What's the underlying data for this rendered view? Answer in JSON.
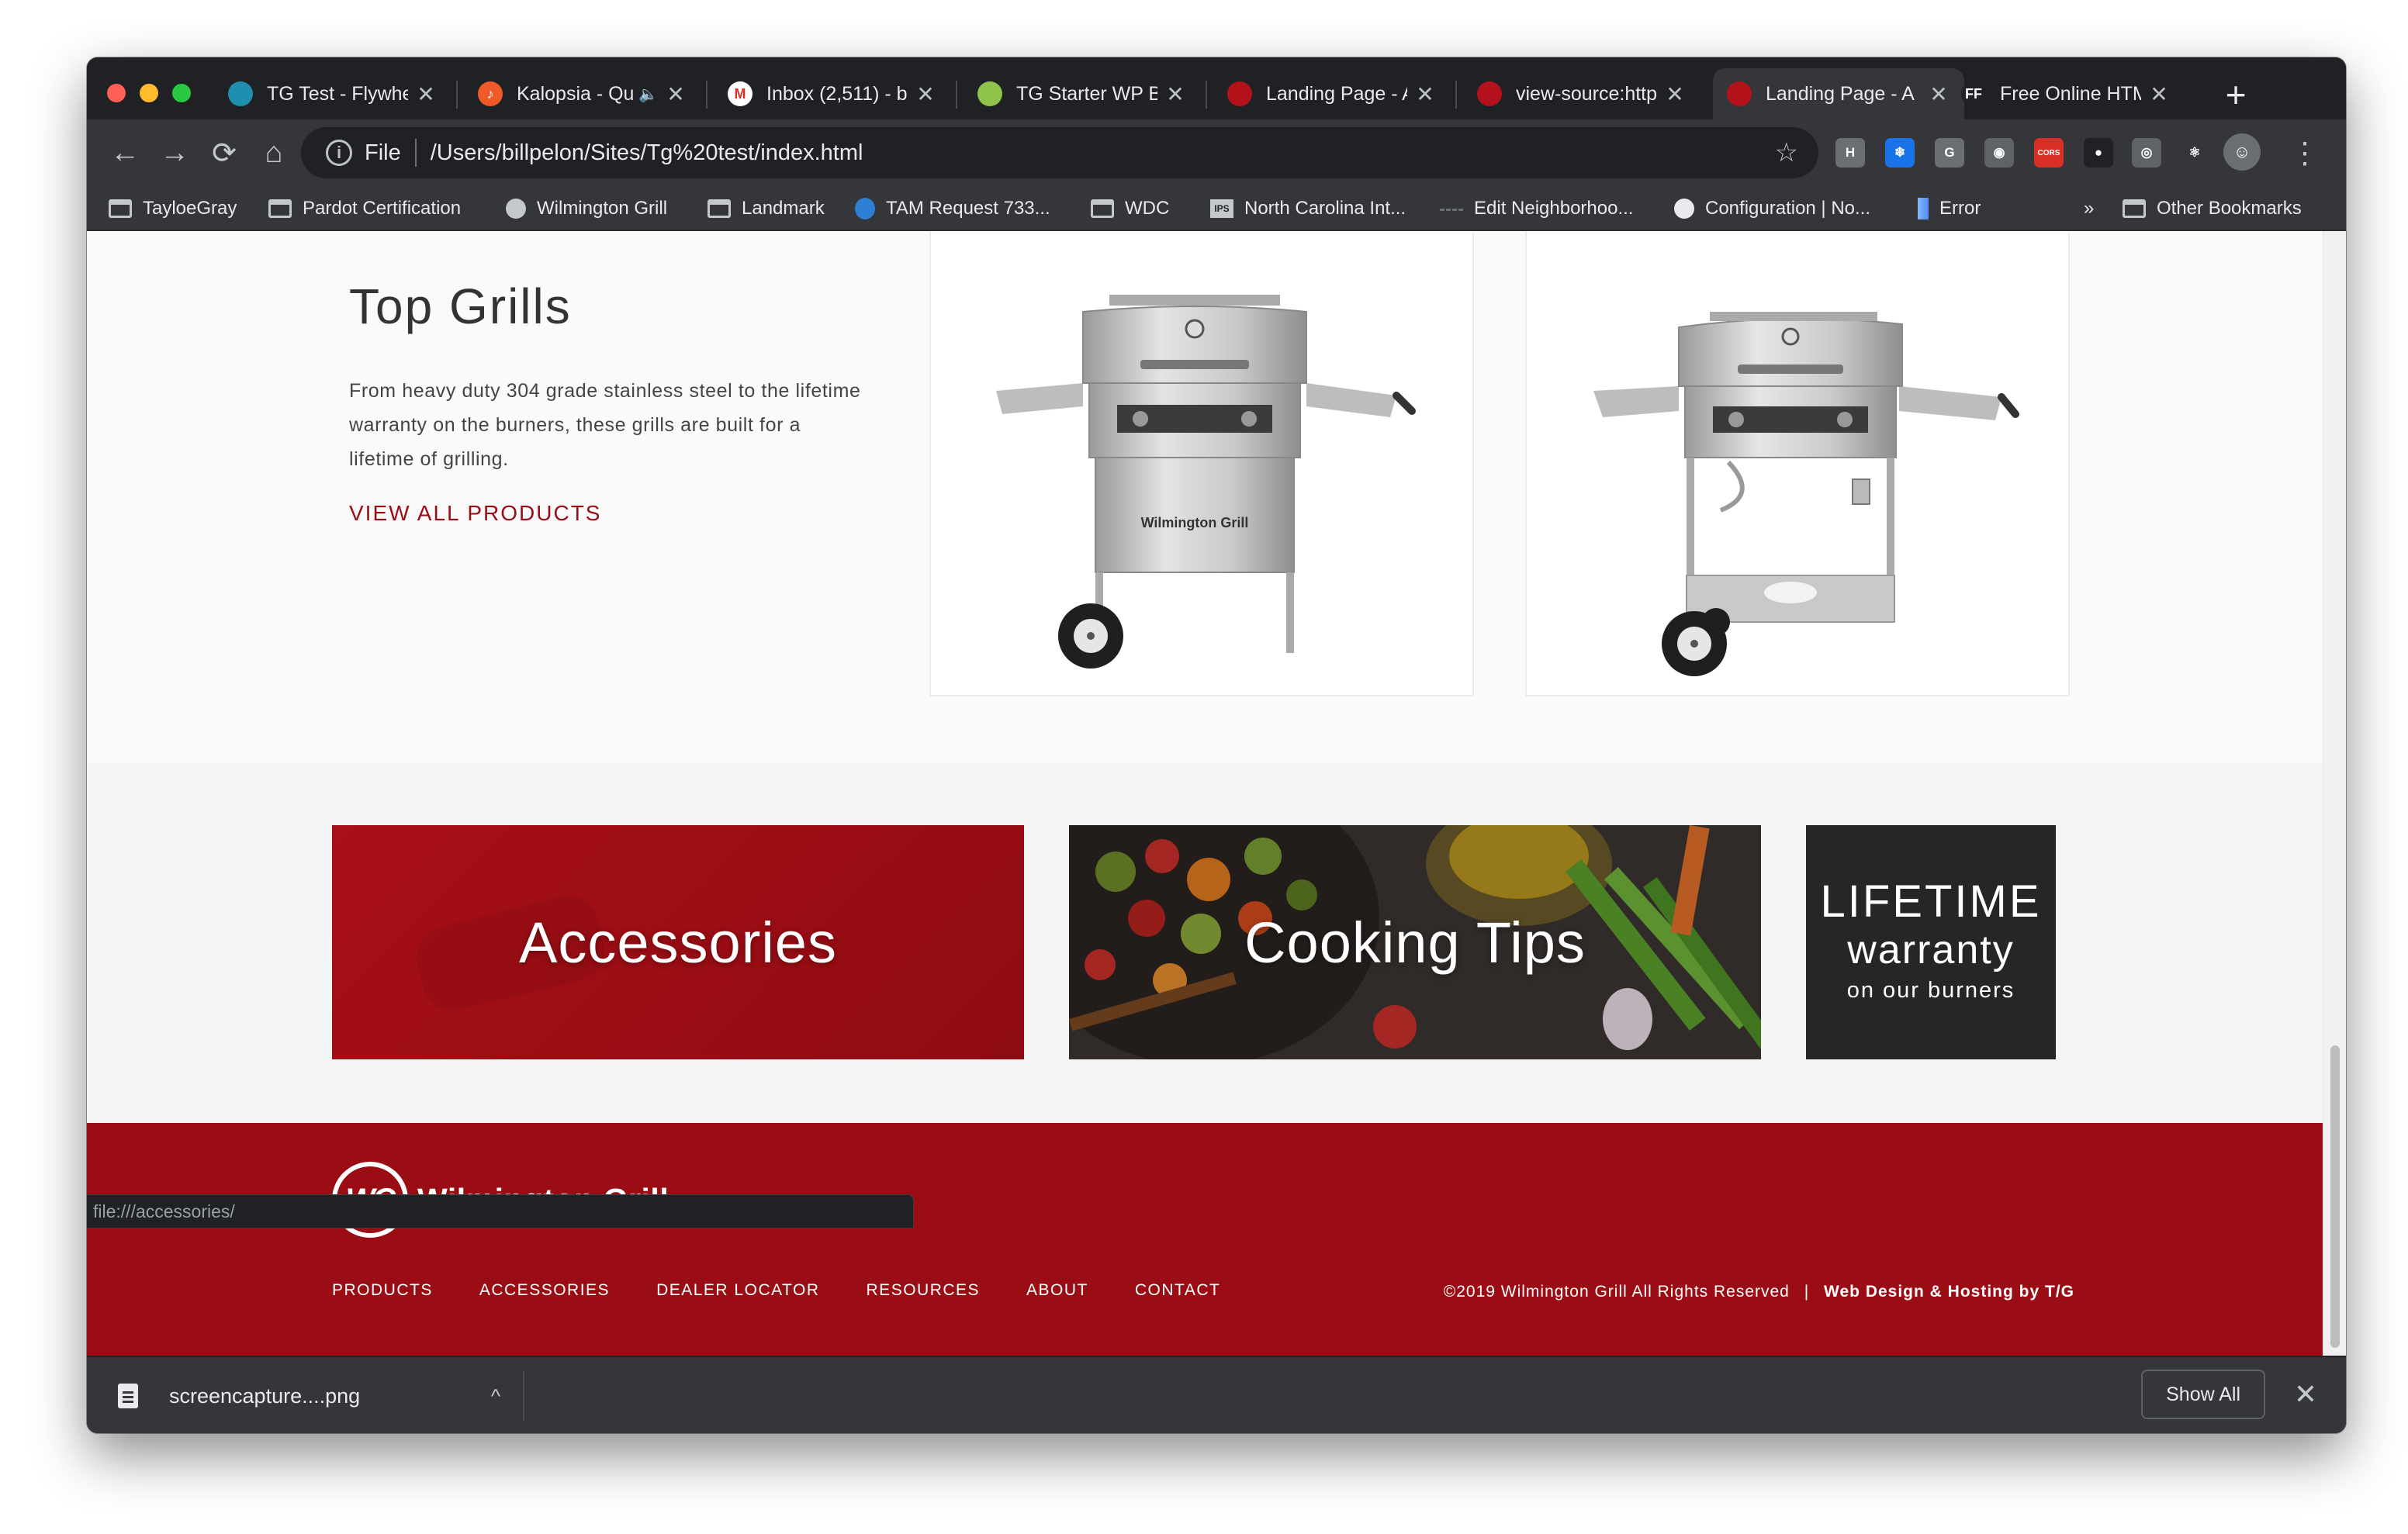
{
  "browser": {
    "tabs": [
      {
        "title": "TG Test - Flywhe",
        "favicon": "flywheel-icon",
        "color": "#1f8fb0",
        "glyph": ""
      },
      {
        "title": "Kalopsia - Qu",
        "favicon": "music-icon",
        "color": "#f05a28",
        "glyph": "♪",
        "audio": "🔈"
      },
      {
        "title": "Inbox (2,511) - bi",
        "favicon": "gmail-icon",
        "color": "#ffffff",
        "glyph": "M"
      },
      {
        "title": "TG Starter WP Bl",
        "favicon": "bitbucket-icon",
        "color": "#8fc34a",
        "glyph": ""
      },
      {
        "title": "Landing Page - A",
        "favicon": "wilmington-grill-icon",
        "color": "#b3121a",
        "glyph": ""
      },
      {
        "title": "view-source:http",
        "favicon": "wilmington-grill-icon",
        "color": "#b3121a",
        "glyph": ""
      },
      {
        "title": "Landing Page - A",
        "favicon": "wilmington-grill-icon",
        "color": "#b3121a",
        "glyph": "",
        "active": true
      },
      {
        "title": "Free Online HTM",
        "favicon": "ff-icon",
        "color": "#202124",
        "glyph": "FF"
      }
    ],
    "tab_close_glyph": "✕",
    "new_tab_glyph": "+",
    "nav": {
      "back": "←",
      "forward": "→",
      "reload": "⟳",
      "home": "⌂",
      "star": "☆",
      "menu": "⋮"
    },
    "address": {
      "info_glyph": "i",
      "scheme": "File",
      "path": "/Users/billpelon/Sites/Tg%20test/index.html"
    },
    "extensions": [
      {
        "name": "hashtag-extension-icon",
        "label": "H",
        "color": "#6b6e73"
      },
      {
        "name": "snowflake-extension-icon",
        "label": "❄",
        "color": "#1a73e8"
      },
      {
        "name": "grammarly-extension-icon",
        "label": "G",
        "color": "#6b6e73"
      },
      {
        "name": "camera-extension-icon",
        "label": "◉",
        "color": "#5f6368"
      },
      {
        "name": "cors-extension-icon",
        "label": "CORS",
        "color": "#d93025"
      },
      {
        "name": "stylus-extension-icon",
        "label": "●",
        "color": "#202124"
      },
      {
        "name": "circle-extension-icon",
        "label": "◎",
        "color": "#5f6368"
      },
      {
        "name": "react-extension-icon",
        "label": "⚛",
        "color": "#35363a"
      },
      {
        "name": "cookie-extension-icon",
        "label": "●",
        "color": "#a0522d"
      }
    ],
    "bookmarks": [
      {
        "label": "TayloeGray",
        "icon": "folder"
      },
      {
        "label": "Pardot Certification",
        "icon": "folder"
      },
      {
        "label": "Wilmington Grill",
        "icon": "globe"
      },
      {
        "label": "Landmark",
        "icon": "folder"
      },
      {
        "label": "TAM Request 733...",
        "icon": "drop"
      },
      {
        "label": "WDC",
        "icon": "folder"
      },
      {
        "label": "North Carolina Int...",
        "icon": "ips"
      },
      {
        "label": "Edit Neighborhoo...",
        "icon": "line"
      },
      {
        "label": "Configuration | No...",
        "icon": "gear"
      },
      {
        "label": "Error",
        "icon": "bar"
      }
    ],
    "bookmarks_overflow": "»",
    "other_bookmarks": "Other Bookmarks"
  },
  "page": {
    "top_grills": {
      "title": "Top Grills",
      "description": "From heavy duty 304 grade stainless steel to the lifetime warranty on the burners, these grills are built for a lifetime of grilling.",
      "link": "VIEW ALL PRODUCTS",
      "grill_badge": "Wilmington Grill"
    },
    "promos": {
      "accessories": "Accessories",
      "cooking": "Cooking Tips",
      "lifetime": {
        "line1": "LIFETIME",
        "line2": "warranty",
        "line3": "on our burners"
      }
    },
    "footer": {
      "logo_mark": "WG",
      "logo_text": "Wilmington Grill",
      "nav": [
        "PRODUCTS",
        "ACCESSORIES",
        "DEALER LOCATOR",
        "RESOURCES",
        "ABOUT",
        "CONTACT"
      ],
      "copyright": "©2019 Wilmington Grill All Rights Reserved",
      "separator": "|",
      "credit": "Web Design & Hosting by T/G"
    },
    "colors": {
      "brand_red": "#9b0d14",
      "promo_gray": "#f3f4f4",
      "lifetime_bg": "#262626"
    }
  },
  "status_url": "file:///accessories/",
  "downloads": {
    "file": "screencapture....png",
    "caret": "^",
    "show_all": "Show All",
    "close": "✕"
  }
}
